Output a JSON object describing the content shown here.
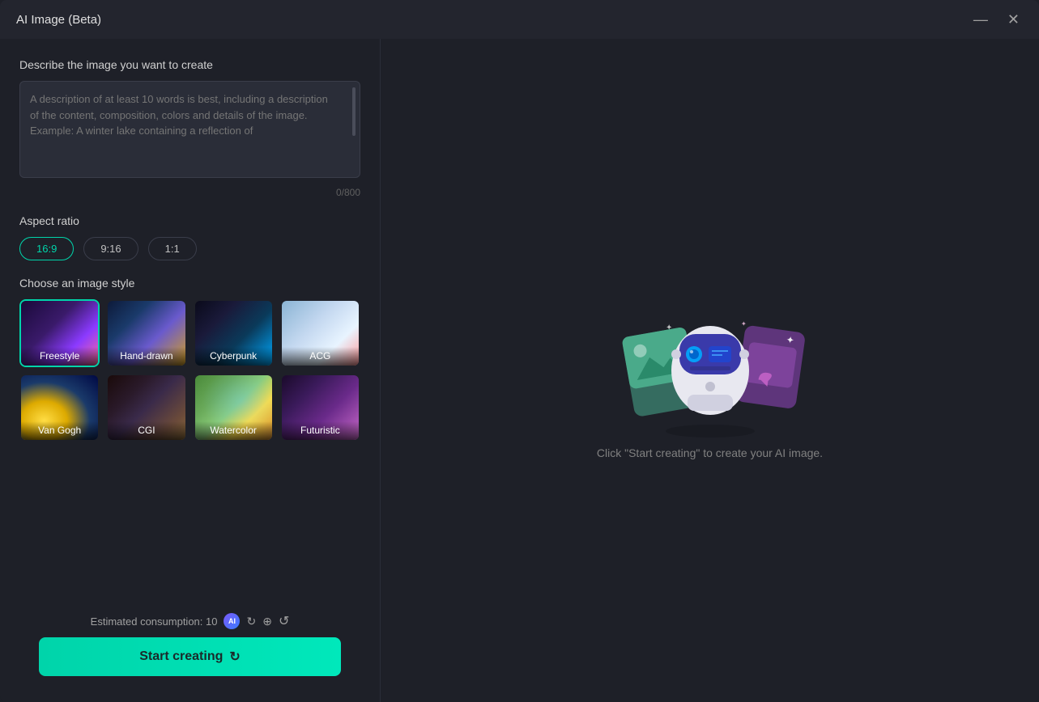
{
  "window": {
    "title": "AI Image (Beta)",
    "minimize_label": "—",
    "close_label": "✕"
  },
  "left": {
    "describe_label": "Describe the image you want to create",
    "textarea_placeholder": "A description of at least 10 words is best, including a description of the content, composition, colors and details of the image. Example: A winter lake containing a reflection of",
    "char_count": "0/800",
    "aspect_ratio_label": "Aspect ratio",
    "aspect_options": [
      "16:9",
      "9:16",
      "1:1"
    ],
    "selected_aspect": "16:9",
    "style_label": "Choose an image style",
    "styles": [
      {
        "id": "freestyle",
        "label": "Freestyle",
        "selected": true
      },
      {
        "id": "handdrawn",
        "label": "Hand-drawn",
        "selected": false
      },
      {
        "id": "cyberpunk",
        "label": "Cyberpunk",
        "selected": false
      },
      {
        "id": "acg",
        "label": "ACG",
        "selected": false
      },
      {
        "id": "vangogh",
        "label": "Van Gogh",
        "selected": false
      },
      {
        "id": "cgi",
        "label": "CGI",
        "selected": false
      },
      {
        "id": "watercolor",
        "label": "Watercolor",
        "selected": false
      },
      {
        "id": "futuristic",
        "label": "Futuristic",
        "selected": false
      }
    ],
    "consumption_label": "Estimated consumption: 10",
    "start_btn_label": "Start creating"
  },
  "right": {
    "hint_text": "Click \"Start creating\" to create your AI image."
  }
}
